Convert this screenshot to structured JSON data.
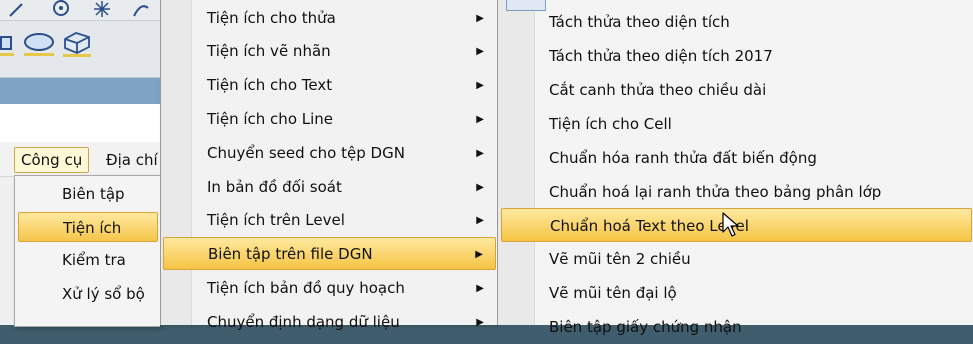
{
  "menubar": {
    "items": [
      {
        "label": "Công cụ"
      },
      {
        "label": "Địa chí"
      }
    ]
  },
  "tools_menu": {
    "items": [
      {
        "label": "Biên tập"
      },
      {
        "label": "Tiện ích"
      },
      {
        "label": "Kiểm tra"
      },
      {
        "label": "Xử lý sổ bộ"
      }
    ]
  },
  "utilities_menu": {
    "items": [
      {
        "label": "Tiện ích cho thửa"
      },
      {
        "label": "Tiện ích vẽ nhãn"
      },
      {
        "label": "Tiện ích cho Text"
      },
      {
        "label": "Tiện ích cho Line"
      },
      {
        "label": "Chuyển seed cho tệp DGN"
      },
      {
        "label": "In bản đồ đối soát"
      },
      {
        "label": "Tiện ích trên Level"
      },
      {
        "label": "Biên tập trên file DGN"
      },
      {
        "label": "Tiện ích bản đồ quy hoạch"
      },
      {
        "label": "Chuyển định dạng dữ liệu"
      }
    ]
  },
  "dgn_menu": {
    "items": [
      {
        "label": "Tách thửa theo diện tích"
      },
      {
        "label": "Tách thửa theo diện tích 2017"
      },
      {
        "label": "Cắt canh thửa theo chiều dài"
      },
      {
        "label": "Tiện ích cho Cell"
      },
      {
        "label": "Chuẩn hóa ranh thửa đất biến động"
      },
      {
        "label": "Chuẩn hoá lại ranh thửa theo bảng phân lớp"
      },
      {
        "label": "Chuẩn hoá Text theo Level"
      },
      {
        "label": "Vẽ mũi tên 2 chiều"
      },
      {
        "label": "Vẽ mũi tên đại lộ"
      },
      {
        "label": "Biên tập giấy chứng nhận"
      }
    ]
  },
  "colors": {
    "highlight": "#f5c444",
    "menu_bg": "#f2f2f2",
    "workspace": "#3f5d6d"
  }
}
